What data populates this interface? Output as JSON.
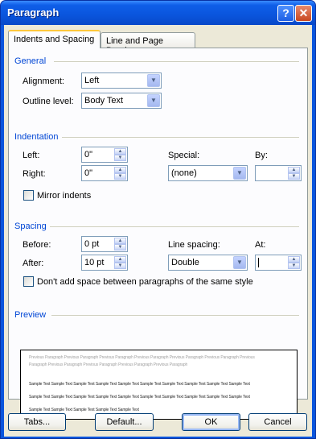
{
  "window": {
    "title": "Paragraph",
    "help_glyph": "?",
    "close_glyph": "✕"
  },
  "tabs": [
    {
      "label": "Indents and Spacing",
      "active": true
    },
    {
      "label": "Line and Page Breaks",
      "active": false
    }
  ],
  "general": {
    "heading": "General",
    "alignment_label": "Alignment:",
    "alignment_value": "Left",
    "outline_label": "Outline level:",
    "outline_value": "Body Text"
  },
  "indentation": {
    "heading": "Indentation",
    "left_label": "Left:",
    "left_value": "0\"",
    "right_label": "Right:",
    "right_value": "0\"",
    "special_label": "Special:",
    "special_value": "(none)",
    "by_label": "By:",
    "by_value": "",
    "mirror_label": "Mirror indents",
    "mirror_checked": false
  },
  "spacing": {
    "heading": "Spacing",
    "before_label": "Before:",
    "before_value": "0 pt",
    "after_label": "After:",
    "after_value": "10 pt",
    "line_spacing_label": "Line spacing:",
    "line_spacing_value": "Double",
    "at_label": "At:",
    "at_value": "",
    "dont_add_label": "Don't add space between paragraphs of the same style",
    "dont_add_checked": false
  },
  "preview": {
    "heading": "Preview",
    "previous_line_1": "Previous Paragraph Previous Paragraph Previous Paragraph Previous Paragraph Previous Paragraph Previous Paragraph Previous",
    "previous_line_2": "Paragraph Previous Paragraph Previous Paragraph Previous Paragraph Previous Paragraph",
    "sample_line_1": "Sample Text Sample Text Sample Text Sample Text Sample Text Sample Text Sample Text Sample Text Sample Text Sample Text",
    "sample_line_2": "Sample Text Sample Text Sample Text Sample Text Sample Text Sample Text Sample Text Sample Text Sample Text Sample Text",
    "sample_line_3": "Sample Text Sample Text Sample Text Sample Text Sample Text"
  },
  "buttons": {
    "tabs": "Tabs...",
    "default": "Default...",
    "ok": "OK",
    "cancel": "Cancel"
  },
  "colors": {
    "titlebar": "#0a55dd",
    "group_heading": "#0046d5",
    "dialog_bg": "#ece9d8",
    "tab_highlight": "#ffc83c"
  }
}
